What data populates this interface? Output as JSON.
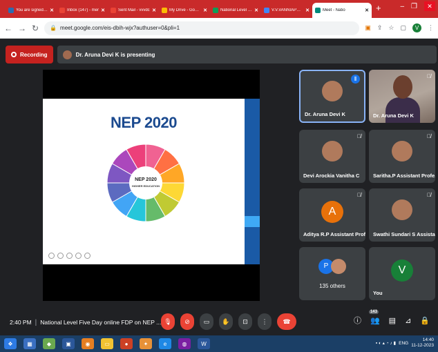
{
  "browser": {
    "tabs": [
      {
        "title": "You are signed in",
        "icon": "sway-icon",
        "color": "#2b6cb0"
      },
      {
        "title": "Inbox (147) - mer",
        "icon": "gmail-icon",
        "color": "#ea4335"
      },
      {
        "title": "Sent Mail - vvvdc",
        "icon": "gmail-icon",
        "color": "#ea4335"
      },
      {
        "title": "My Drive - Google",
        "icon": "drive-icon",
        "color": "#fbbc04"
      },
      {
        "title": "National Level FD",
        "icon": "sheets-icon",
        "color": "#0f9d58"
      },
      {
        "title": "V.V.VANNIAPERUM",
        "icon": "docs-icon",
        "color": "#4285f4"
      },
      {
        "title": "Meet - Natio",
        "icon": "meet-icon",
        "color": "#00897b",
        "active": true
      }
    ],
    "url": "meet.google.com/eis-dbih-wjx?authuser=0&pli=1",
    "profile_initial": "V"
  },
  "meet": {
    "recording_label": "Recording",
    "presenting_label": "Dr. Aruna Devi K is presenting",
    "slide_title": "NEP 2020",
    "slide_center_line1": "NEP 2020",
    "slide_center_line2": "HIGHER EDUCATION",
    "participants": [
      {
        "name": "Dr. Aruna Devi K",
        "type": "photo",
        "talking": true
      },
      {
        "name": "Dr. Aruna Devi K",
        "type": "camera",
        "talking": false
      },
      {
        "name": "Devi Arockia Vanitha C",
        "type": "photo",
        "talking": false
      },
      {
        "name": "Saritha.P Assistant Profe...",
        "type": "photo",
        "talking": false
      },
      {
        "name": "Aditya R.P Assistant Prof...",
        "type": "letter",
        "letter": "A",
        "color": "#e8710a",
        "talking": false
      },
      {
        "name": "Swathi Sundari S Assista...",
        "type": "photo",
        "talking": false
      },
      {
        "name": "135 others",
        "type": "others",
        "letter": "P",
        "talking": false
      },
      {
        "name": "You",
        "type": "letter",
        "letter": "V",
        "color": "#188038",
        "talking": false
      }
    ],
    "time": "2:40 PM",
    "meeting_name": "National Level Five Day online FDP on NEP ...",
    "people_count": "143"
  },
  "taskbar": {
    "lang": "ENG",
    "clock_time": "14:40",
    "clock_date": "11-12-2023"
  }
}
